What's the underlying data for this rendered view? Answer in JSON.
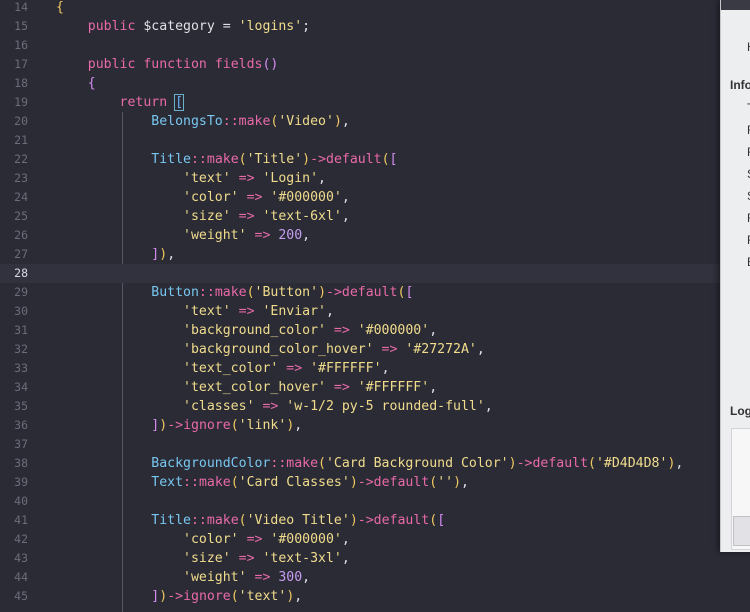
{
  "editor": {
    "current_line": 28,
    "lines": [
      {
        "n": "14",
        "tokens": [
          [
            "{",
            "t-br"
          ]
        ]
      },
      {
        "n": "15",
        "tokens": [
          [
            "    ",
            "t-p"
          ],
          [
            "public",
            "t-kw"
          ],
          [
            " $category = ",
            "t-var"
          ],
          [
            "'logins'",
            "t-str"
          ],
          [
            ";",
            "t-p"
          ]
        ]
      },
      {
        "n": "16",
        "tokens": []
      },
      {
        "n": "17",
        "tokens": [
          [
            "    ",
            "t-p"
          ],
          [
            "public",
            "t-kw"
          ],
          [
            " ",
            "t-p"
          ],
          [
            "function",
            "t-kw"
          ],
          [
            " ",
            "t-p"
          ],
          [
            "fields",
            "t-fn"
          ],
          [
            "()",
            "t-br2"
          ]
        ]
      },
      {
        "n": "18",
        "tokens": [
          [
            "    ",
            "t-p"
          ],
          [
            "{",
            "t-br2"
          ]
        ]
      },
      {
        "n": "19",
        "tokens": [
          [
            "        ",
            "t-p"
          ],
          [
            "return",
            "t-kw"
          ],
          [
            " ",
            "t-p"
          ],
          [
            "[",
            "t-br3 t-match"
          ]
        ]
      },
      {
        "n": "20",
        "tokens": [
          [
            "            ",
            "t-p"
          ],
          [
            "BelongsTo",
            "t-cls"
          ],
          [
            "::",
            "t-op"
          ],
          [
            "make",
            "t-fn"
          ],
          [
            "(",
            "t-br"
          ],
          [
            "'Video'",
            "t-str"
          ],
          [
            ")",
            "t-br"
          ],
          [
            ",",
            "t-p"
          ]
        ]
      },
      {
        "n": "21",
        "tokens": []
      },
      {
        "n": "22",
        "tokens": [
          [
            "            ",
            "t-p"
          ],
          [
            "Title",
            "t-cls"
          ],
          [
            "::",
            "t-op"
          ],
          [
            "make",
            "t-fn"
          ],
          [
            "(",
            "t-br"
          ],
          [
            "'Title'",
            "t-str"
          ],
          [
            ")",
            "t-br"
          ],
          [
            "->",
            "t-op"
          ],
          [
            "default",
            "t-fn"
          ],
          [
            "(",
            "t-br"
          ],
          [
            "[",
            "t-br2"
          ]
        ]
      },
      {
        "n": "23",
        "tokens": [
          [
            "                ",
            "t-p"
          ],
          [
            "'text'",
            "t-str"
          ],
          [
            " => ",
            "t-op"
          ],
          [
            "'Login'",
            "t-str"
          ],
          [
            ",",
            "t-p"
          ]
        ]
      },
      {
        "n": "24",
        "tokens": [
          [
            "                ",
            "t-p"
          ],
          [
            "'color'",
            "t-str"
          ],
          [
            " => ",
            "t-op"
          ],
          [
            "'#000000'",
            "t-str"
          ],
          [
            ",",
            "t-p"
          ]
        ]
      },
      {
        "n": "25",
        "tokens": [
          [
            "                ",
            "t-p"
          ],
          [
            "'size'",
            "t-str"
          ],
          [
            " => ",
            "t-op"
          ],
          [
            "'text-6xl'",
            "t-str"
          ],
          [
            ",",
            "t-p"
          ]
        ]
      },
      {
        "n": "26",
        "tokens": [
          [
            "                ",
            "t-p"
          ],
          [
            "'weight'",
            "t-str"
          ],
          [
            " => ",
            "t-op"
          ],
          [
            "200",
            "t-num"
          ],
          [
            ",",
            "t-p"
          ]
        ]
      },
      {
        "n": "27",
        "tokens": [
          [
            "            ",
            "t-p"
          ],
          [
            "]",
            "t-br2"
          ],
          [
            ")",
            "t-br"
          ],
          [
            ",",
            "t-p"
          ]
        ]
      },
      {
        "n": "28",
        "tokens": []
      },
      {
        "n": "29",
        "tokens": [
          [
            "            ",
            "t-p"
          ],
          [
            "Button",
            "t-cls"
          ],
          [
            "::",
            "t-op"
          ],
          [
            "make",
            "t-fn"
          ],
          [
            "(",
            "t-br"
          ],
          [
            "'Button'",
            "t-str"
          ],
          [
            ")",
            "t-br"
          ],
          [
            "->",
            "t-op"
          ],
          [
            "default",
            "t-fn"
          ],
          [
            "(",
            "t-br"
          ],
          [
            "[",
            "t-br2"
          ]
        ]
      },
      {
        "n": "30",
        "tokens": [
          [
            "                ",
            "t-p"
          ],
          [
            "'text'",
            "t-str"
          ],
          [
            " => ",
            "t-op"
          ],
          [
            "'Enviar'",
            "t-str"
          ],
          [
            ",",
            "t-p"
          ]
        ]
      },
      {
        "n": "31",
        "tokens": [
          [
            "                ",
            "t-p"
          ],
          [
            "'background_color'",
            "t-str"
          ],
          [
            " => ",
            "t-op"
          ],
          [
            "'#000000'",
            "t-str"
          ],
          [
            ",",
            "t-p"
          ]
        ]
      },
      {
        "n": "32",
        "tokens": [
          [
            "                ",
            "t-p"
          ],
          [
            "'background_color_hover'",
            "t-str"
          ],
          [
            " => ",
            "t-op"
          ],
          [
            "'#27272A'",
            "t-str"
          ],
          [
            ",",
            "t-p"
          ]
        ]
      },
      {
        "n": "33",
        "tokens": [
          [
            "                ",
            "t-p"
          ],
          [
            "'text_color'",
            "t-str"
          ],
          [
            " => ",
            "t-op"
          ],
          [
            "'#FFFFFF'",
            "t-str"
          ],
          [
            ",",
            "t-p"
          ]
        ]
      },
      {
        "n": "34",
        "tokens": [
          [
            "                ",
            "t-p"
          ],
          [
            "'text_color_hover'",
            "t-str"
          ],
          [
            " => ",
            "t-op"
          ],
          [
            "'#FFFFFF'",
            "t-str"
          ],
          [
            ",",
            "t-p"
          ]
        ]
      },
      {
        "n": "35",
        "tokens": [
          [
            "                ",
            "t-p"
          ],
          [
            "'classes'",
            "t-str"
          ],
          [
            " => ",
            "t-op"
          ],
          [
            "'w-1/2 py-5 rounded-full'",
            "t-str"
          ],
          [
            ",",
            "t-p"
          ]
        ]
      },
      {
        "n": "36",
        "tokens": [
          [
            "            ",
            "t-p"
          ],
          [
            "]",
            "t-br2"
          ],
          [
            ")",
            "t-br"
          ],
          [
            "->",
            "t-op"
          ],
          [
            "ignore",
            "t-fn"
          ],
          [
            "(",
            "t-br"
          ],
          [
            "'link'",
            "t-str"
          ],
          [
            ")",
            "t-br"
          ],
          [
            ",",
            "t-p"
          ]
        ]
      },
      {
        "n": "37",
        "tokens": []
      },
      {
        "n": "38",
        "tokens": [
          [
            "            ",
            "t-p"
          ],
          [
            "BackgroundColor",
            "t-cls"
          ],
          [
            "::",
            "t-op"
          ],
          [
            "make",
            "t-fn"
          ],
          [
            "(",
            "t-br"
          ],
          [
            "'Card Background Color'",
            "t-str"
          ],
          [
            ")",
            "t-br"
          ],
          [
            "->",
            "t-op"
          ],
          [
            "default",
            "t-fn"
          ],
          [
            "(",
            "t-br"
          ],
          [
            "'#D4D4D8'",
            "t-str"
          ],
          [
            ")",
            "t-br"
          ],
          [
            ",",
            "t-p"
          ]
        ]
      },
      {
        "n": "39",
        "tokens": [
          [
            "            ",
            "t-p"
          ],
          [
            "Text",
            "t-cls"
          ],
          [
            "::",
            "t-op"
          ],
          [
            "make",
            "t-fn"
          ],
          [
            "(",
            "t-br"
          ],
          [
            "'Card Classes'",
            "t-str"
          ],
          [
            ")",
            "t-br"
          ],
          [
            "->",
            "t-op"
          ],
          [
            "default",
            "t-fn"
          ],
          [
            "(",
            "t-br"
          ],
          [
            "''",
            "t-str"
          ],
          [
            ")",
            "t-br"
          ],
          [
            ",",
            "t-p"
          ]
        ]
      },
      {
        "n": "40",
        "tokens": []
      },
      {
        "n": "41",
        "tokens": [
          [
            "            ",
            "t-p"
          ],
          [
            "Title",
            "t-cls"
          ],
          [
            "::",
            "t-op"
          ],
          [
            "make",
            "t-fn"
          ],
          [
            "(",
            "t-br"
          ],
          [
            "'Video Title'",
            "t-str"
          ],
          [
            ")",
            "t-br"
          ],
          [
            "->",
            "t-op"
          ],
          [
            "default",
            "t-fn"
          ],
          [
            "(",
            "t-br"
          ],
          [
            "[",
            "t-br2"
          ]
        ]
      },
      {
        "n": "42",
        "tokens": [
          [
            "                ",
            "t-p"
          ],
          [
            "'color'",
            "t-str"
          ],
          [
            " => ",
            "t-op"
          ],
          [
            "'#000000'",
            "t-str"
          ],
          [
            ",",
            "t-p"
          ]
        ]
      },
      {
        "n": "43",
        "tokens": [
          [
            "                ",
            "t-p"
          ],
          [
            "'size'",
            "t-str"
          ],
          [
            " => ",
            "t-op"
          ],
          [
            "'text-3xl'",
            "t-str"
          ],
          [
            ",",
            "t-p"
          ]
        ]
      },
      {
        "n": "44",
        "tokens": [
          [
            "                ",
            "t-p"
          ],
          [
            "'weight'",
            "t-str"
          ],
          [
            " => ",
            "t-op"
          ],
          [
            "300",
            "t-num"
          ],
          [
            ",",
            "t-p"
          ]
        ]
      },
      {
        "n": "45",
        "tokens": [
          [
            "            ",
            "t-p"
          ],
          [
            "]",
            "t-br2"
          ],
          [
            ")",
            "t-br"
          ],
          [
            "->",
            "t-op"
          ],
          [
            "ignore",
            "t-fn"
          ],
          [
            "(",
            "t-br"
          ],
          [
            "'text'",
            "t-str"
          ],
          [
            ")",
            "t-br"
          ],
          [
            ",",
            "t-p"
          ]
        ]
      }
    ]
  },
  "side_panel": {
    "top_letter": "H",
    "section_info": "Info",
    "info_letters": [
      "T",
      "F",
      "F",
      "S",
      "S",
      "F",
      "F",
      "E"
    ],
    "section_log": "Log"
  }
}
